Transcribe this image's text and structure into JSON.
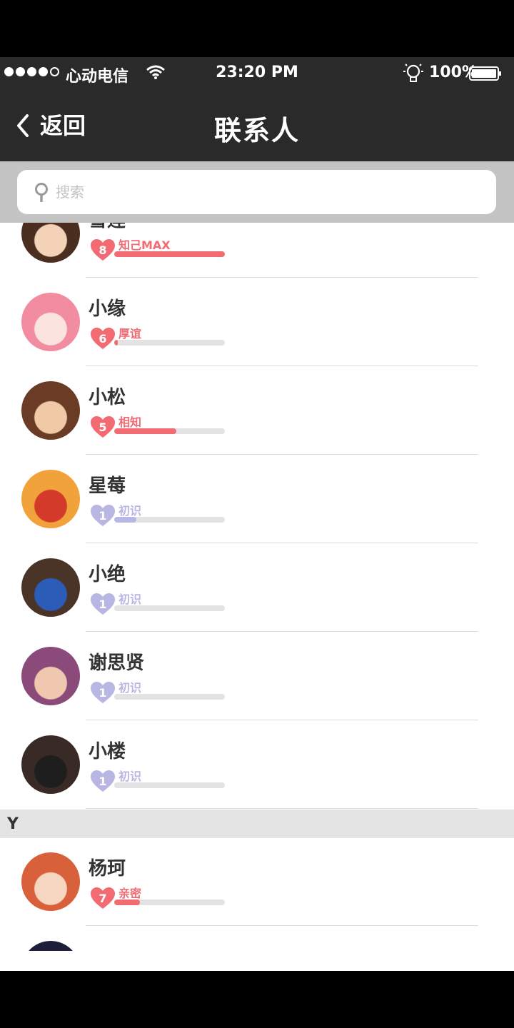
{
  "status_bar": {
    "carrier": "心动电信",
    "time": "23:20 PM",
    "battery": "100%",
    "signal_bars_filled": 4,
    "signal_bars_total": 5,
    "icons": [
      "signal-dots-icon",
      "wifi-icon",
      "bulb-icon",
      "battery-icon"
    ]
  },
  "nav": {
    "back_label": "返回",
    "title": "联系人"
  },
  "search": {
    "placeholder": "搜索",
    "value": ""
  },
  "colors": {
    "bar_bg": "#2a2a2a",
    "pink": "#f26b73",
    "lavender": "#b8b6e2",
    "track": "#e3e3e3",
    "section_bg": "#e4e4e4"
  },
  "sections": [
    {
      "header": "",
      "contacts": [
        {
          "name": "雪莲",
          "level": "8",
          "level_label": "知己MAX",
          "progress": 1.0,
          "tier": "pink",
          "avatar_colors": [
            "#4a2e1f",
            "#f3d2b7"
          ]
        },
        {
          "name": "小缘",
          "level": "6",
          "level_label": "厚谊",
          "progress": 0.03,
          "tier": "pink",
          "avatar_colors": [
            "#f28ca0",
            "#fbe3e0"
          ]
        },
        {
          "name": "小松",
          "level": "5",
          "level_label": "相知",
          "progress": 0.56,
          "tier": "pink",
          "avatar_colors": [
            "#6a3b25",
            "#f0c9a6"
          ]
        },
        {
          "name": "星莓",
          "level": "1",
          "level_label": "初识",
          "progress": 0.2,
          "tier": "lavender",
          "avatar_colors": [
            "#f2a23a",
            "#d43a2a"
          ]
        },
        {
          "name": "小绝",
          "level": "1",
          "level_label": "初识",
          "progress": 0.0,
          "tier": "lavender",
          "avatar_colors": [
            "#4a3428",
            "#2b5db8"
          ]
        },
        {
          "name": "谢思贤",
          "level": "1",
          "level_label": "初识",
          "progress": 0.0,
          "tier": "lavender",
          "avatar_colors": [
            "#8a4a7a",
            "#f0c8b0"
          ]
        },
        {
          "name": "小楼",
          "level": "1",
          "level_label": "初识",
          "progress": 0.0,
          "tier": "lavender",
          "avatar_colors": [
            "#3a2a26",
            "#1e1e1e"
          ]
        }
      ]
    },
    {
      "header": "Y",
      "contacts": [
        {
          "name": "杨珂",
          "level": "7",
          "level_label": "亲密",
          "progress": 0.23,
          "tier": "pink",
          "avatar_colors": [
            "#d8603a",
            "#f6d6c0"
          ]
        },
        {
          "name": "",
          "level": "",
          "level_label": "",
          "progress": 0.0,
          "tier": "lavender",
          "avatar_colors": [
            "#1e1e3a",
            "#d8c8d8"
          ]
        }
      ]
    }
  ]
}
